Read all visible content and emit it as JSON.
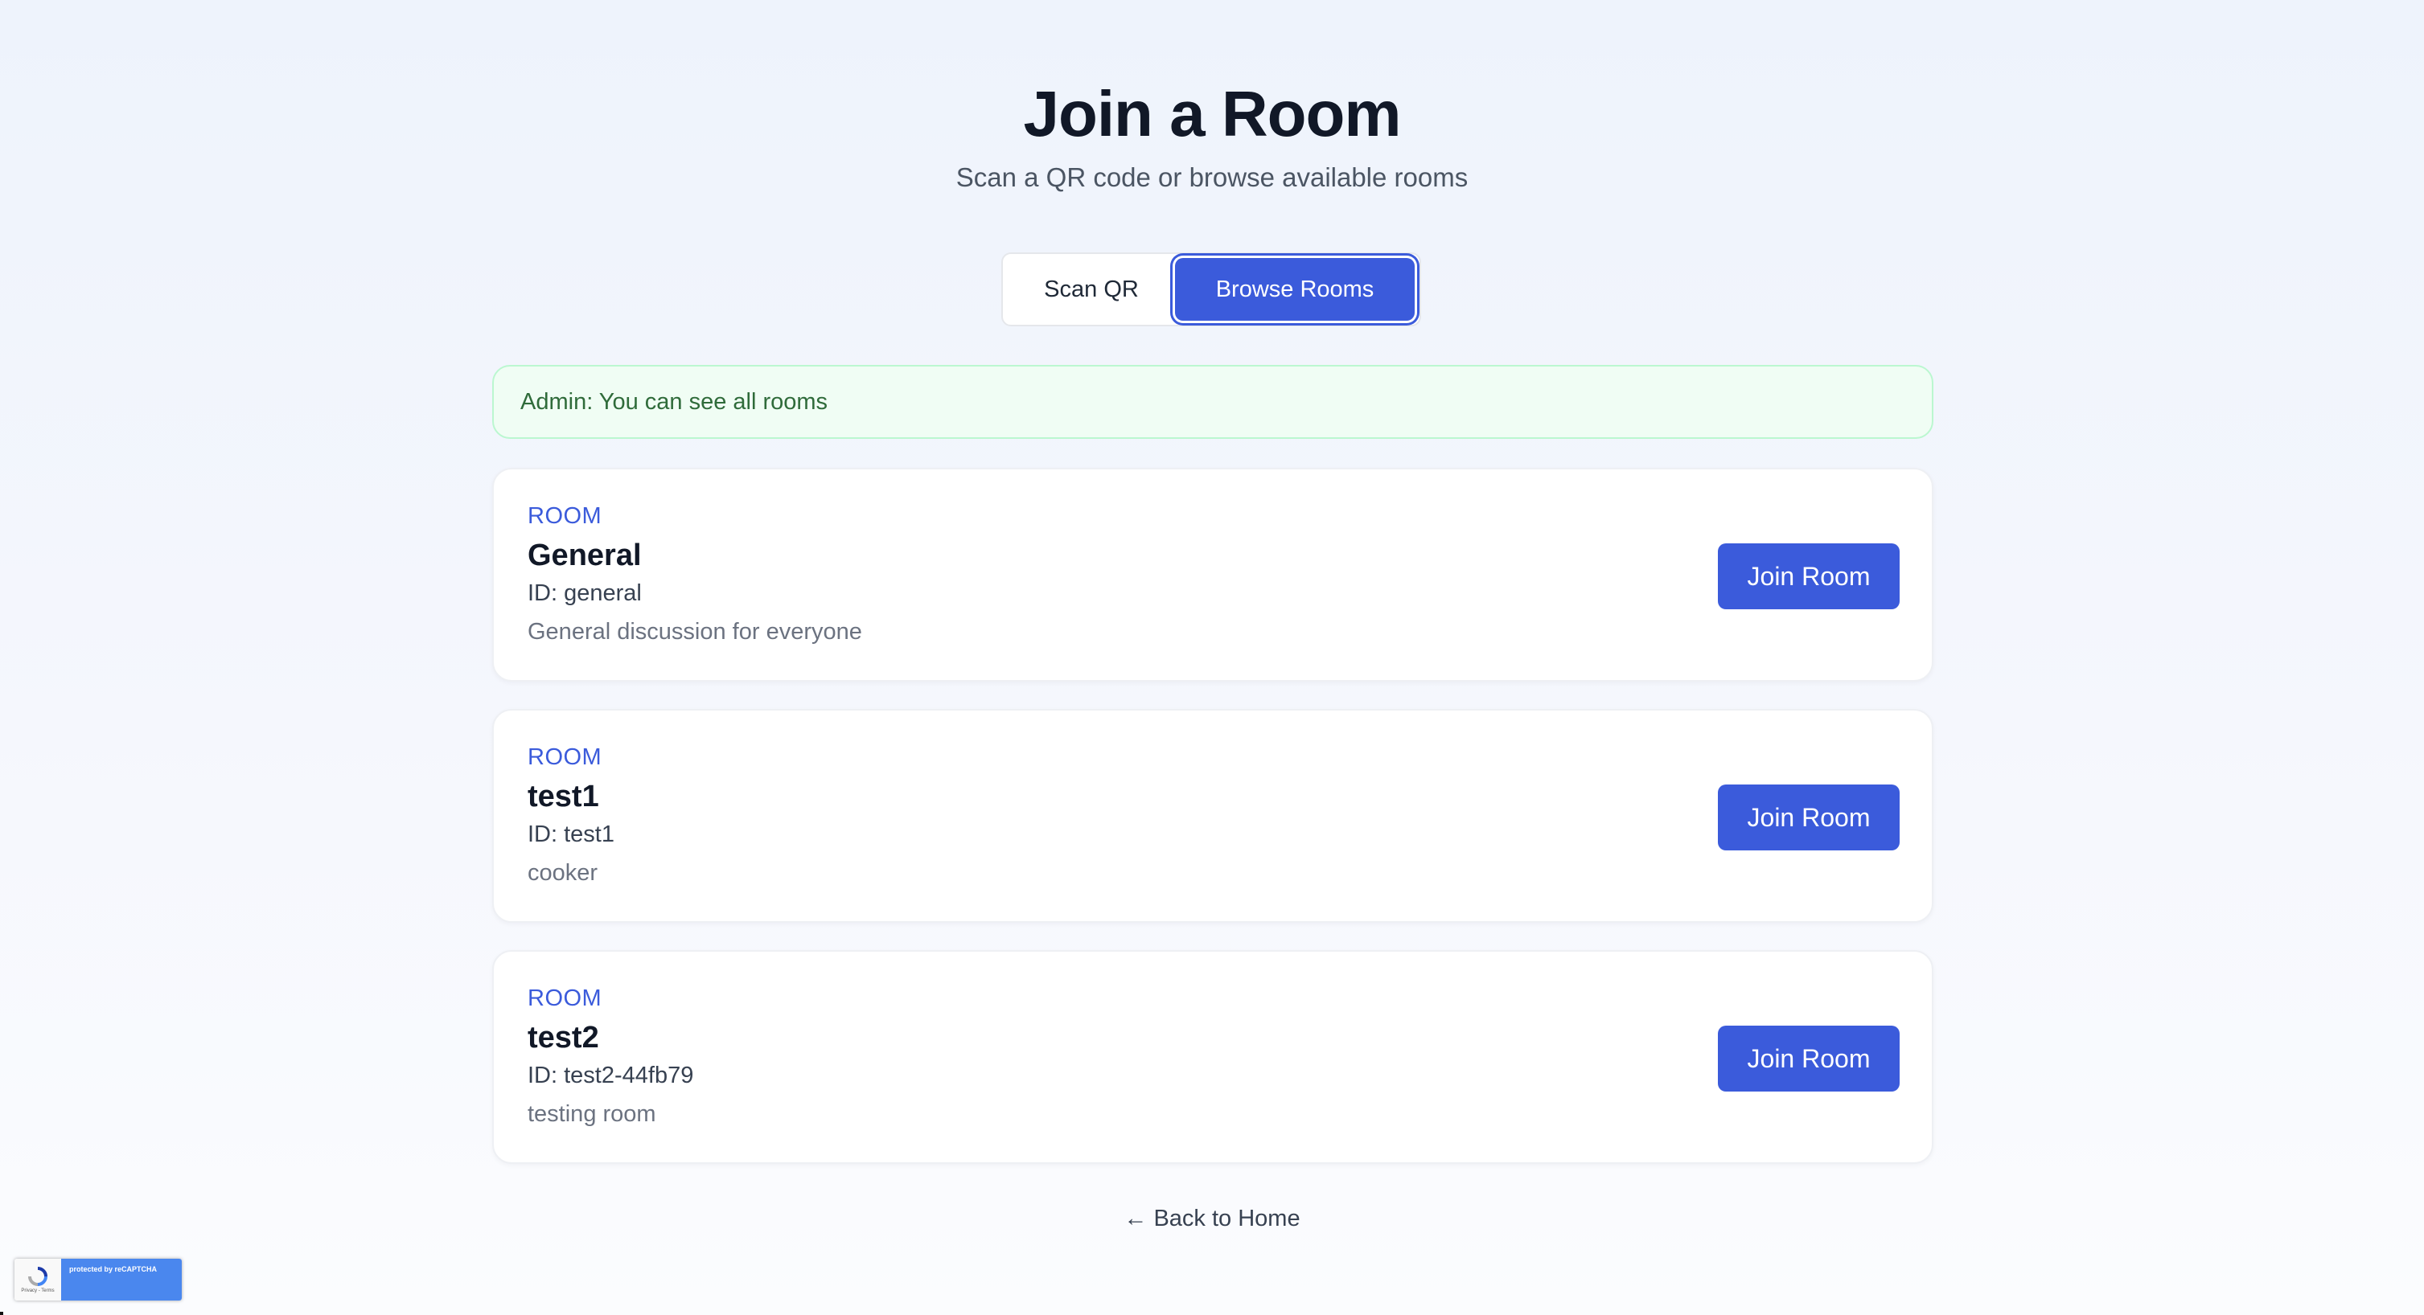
{
  "header": {
    "title": "Join a Room",
    "subtitle": "Scan a QR code or browse available rooms"
  },
  "tabs": [
    {
      "label": "Scan QR",
      "active": false
    },
    {
      "label": "Browse Rooms",
      "active": true
    }
  ],
  "alert": {
    "text": "Admin: You can see all rooms"
  },
  "rooms": [
    {
      "tag": "ROOM",
      "name": "General",
      "id_text": "ID: general",
      "description": "General discussion for everyone",
      "button_label": "Join Room"
    },
    {
      "tag": "ROOM",
      "name": "test1",
      "id_text": "ID: test1",
      "description": "cooker",
      "button_label": "Join Room"
    },
    {
      "tag": "ROOM",
      "name": "test2",
      "id_text": "ID: test2-44fb79",
      "description": "testing room",
      "button_label": "Join Room"
    }
  ],
  "footer": {
    "back_link": "← Back to Home"
  },
  "recaptcha": {
    "text": "protected by reCAPTCHA",
    "terms": "Privacy - Terms",
    "icon": "recaptcha-icon"
  },
  "colors": {
    "accent": "#3b5bdb",
    "alert_bg": "#f0fdf4",
    "alert_text": "#2f6b3a"
  }
}
